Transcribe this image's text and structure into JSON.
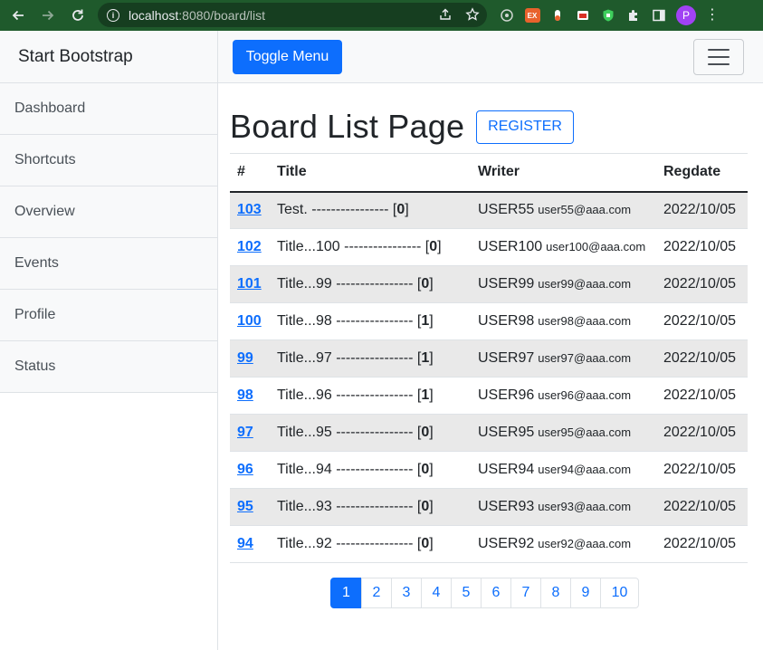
{
  "browser": {
    "url_host": "localhost",
    "url_rest": ":8080/board/list"
  },
  "sidebar": {
    "heading": "Start Bootstrap",
    "items": [
      {
        "label": "Dashboard"
      },
      {
        "label": "Shortcuts"
      },
      {
        "label": "Overview"
      },
      {
        "label": "Events"
      },
      {
        "label": "Profile"
      },
      {
        "label": "Status"
      }
    ]
  },
  "topbar": {
    "toggle_label": "Toggle Menu"
  },
  "main": {
    "title": "Board List Page",
    "register_label": "REGISTER",
    "columns": [
      "#",
      "Title",
      "Writer",
      "Regdate"
    ],
    "rows": [
      {
        "bno": "103",
        "title": "Test. ---------------- [",
        "replies": "0",
        "writer": "USER55",
        "email": "user55@aaa.com",
        "regdate": "2022/10/05"
      },
      {
        "bno": "102",
        "title": "Title...100 ---------------- [",
        "replies": "0",
        "writer": "USER100",
        "email": "user100@aaa.com",
        "regdate": "2022/10/05"
      },
      {
        "bno": "101",
        "title": "Title...99 ---------------- [",
        "replies": "0",
        "writer": "USER99",
        "email": "user99@aaa.com",
        "regdate": "2022/10/05"
      },
      {
        "bno": "100",
        "title": "Title...98 ---------------- [",
        "replies": "1",
        "writer": "USER98",
        "email": "user98@aaa.com",
        "regdate": "2022/10/05"
      },
      {
        "bno": "99",
        "title": "Title...97 ---------------- [",
        "replies": "1",
        "writer": "USER97",
        "email": "user97@aaa.com",
        "regdate": "2022/10/05"
      },
      {
        "bno": "98",
        "title": "Title...96 ---------------- [",
        "replies": "1",
        "writer": "USER96",
        "email": "user96@aaa.com",
        "regdate": "2022/10/05"
      },
      {
        "bno": "97",
        "title": "Title...95 ---------------- [",
        "replies": "0",
        "writer": "USER95",
        "email": "user95@aaa.com",
        "regdate": "2022/10/05"
      },
      {
        "bno": "96",
        "title": "Title...94 ---------------- [",
        "replies": "0",
        "writer": "USER94",
        "email": "user94@aaa.com",
        "regdate": "2022/10/05"
      },
      {
        "bno": "95",
        "title": "Title...93 ---------------- [",
        "replies": "0",
        "writer": "USER93",
        "email": "user93@aaa.com",
        "regdate": "2022/10/05"
      },
      {
        "bno": "94",
        "title": "Title...92 ---------------- [",
        "replies": "0",
        "writer": "USER92",
        "email": "user92@aaa.com",
        "regdate": "2022/10/05"
      }
    ]
  },
  "pagination": {
    "pages": [
      "1",
      "2",
      "3",
      "4",
      "5",
      "6",
      "7",
      "8",
      "9",
      "10"
    ],
    "active": "1"
  },
  "colors": {
    "primary": "#0d6efd",
    "chrome": "#1f5a2c"
  }
}
